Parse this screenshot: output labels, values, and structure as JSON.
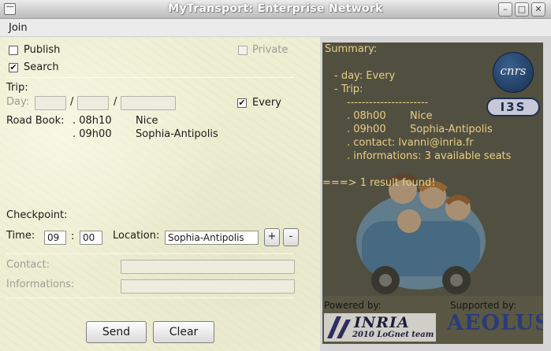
{
  "window": {
    "title": "MyTransport: Enterprise Network",
    "buttons": {
      "minimize": "–",
      "maximize": "□",
      "close": "✕"
    }
  },
  "menu": {
    "join": "Join"
  },
  "form": {
    "publish_label": "Publish",
    "publish_checked": false,
    "search_label": "Search",
    "search_checked": true,
    "private_label": "Private",
    "private_checked": false,
    "trip_label": "Trip:",
    "day_label": "Day:",
    "date_separator": "/",
    "every_label": "Every",
    "every_checked": true,
    "roadbook_label": "Road Book:",
    "roadbook": [
      {
        "time": ". 08h10",
        "place": "Nice"
      },
      {
        "time": ". 09h00",
        "place": "Sophia-Antipolis"
      }
    ],
    "checkpoint_label": "Checkpoint:",
    "time_label": "Time:",
    "time_hour": "09",
    "time_colon": ":",
    "time_minute": "00",
    "location_label": "Location:",
    "location_value": "Sophia-Antipolis",
    "add_label": "+",
    "remove_label": "-",
    "contact_label": "Contact:",
    "informations_label": "Informations:",
    "send_label": "Send",
    "clear_label": "Clear"
  },
  "summary": {
    "title": "Summary:",
    "day_line": "- day: Every",
    "trip_line": "- Trip:",
    "divider": "----------------------",
    "stop1_time": ". 08h00",
    "stop1_place": "Nice",
    "stop2_time": ". 09h00",
    "stop2_place": "Sophia-Antipolis",
    "contact_line": ". contact: lvanni@inria.fr",
    "info_line": ". informations: 3 available seats",
    "result_line": "===> 1 result found!",
    "logo_cnrs": "cnrs",
    "logo_i3s": "I3S",
    "powered_by": "Powered by:",
    "supported_by": "Supported by:",
    "inria_logo": "INRIA",
    "inria_team": "2010 LoGnet team",
    "aeolus_logo": "AEOLUS"
  },
  "colors": {
    "panel_bg": "#eeeed3",
    "summary_bg": "#514f40",
    "summary_text": "#e7cf85"
  }
}
